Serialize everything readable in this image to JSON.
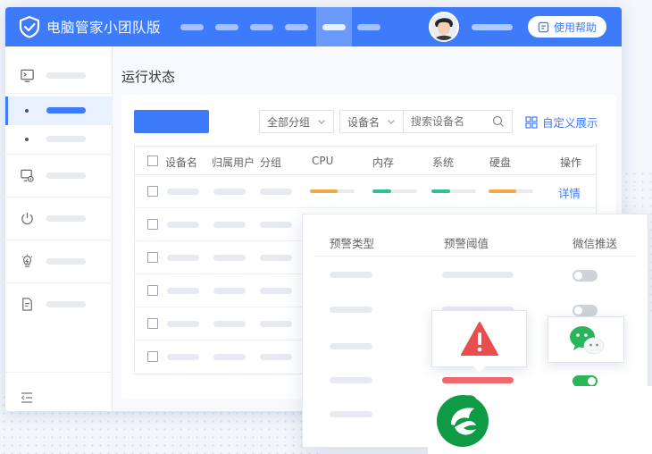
{
  "app": {
    "title": "电脑管家小团队版",
    "help_label": "使用帮助"
  },
  "colors": {
    "accent": "#3d7bfa",
    "warning": "#e94e4e",
    "success": "#2bb55a",
    "cpu_bar": "#f0a84a",
    "mem_bar": "#2ec28c"
  },
  "page": {
    "title": "运行状态"
  },
  "toolbar": {
    "group_select": "全部分组",
    "device_select": "设备名",
    "search_placeholder": "搜索设备名",
    "custom_label": "自定义展示"
  },
  "table": {
    "headers": [
      "设备名",
      "归属用户",
      "分组",
      "CPU",
      "内存",
      "系统",
      "硬盘",
      "操作"
    ],
    "first_row_action": "详情",
    "first_row_levels": {
      "cpu": 0.62,
      "mem": 0.42,
      "sys": 0.42,
      "disk": 0.62
    }
  },
  "alert_panel": {
    "headers": [
      "预警类型",
      "预警阈值",
      "微信推送"
    ],
    "toggles": [
      false,
      false,
      false,
      true,
      null
    ]
  },
  "icons": {
    "logo": "shield-check-icon",
    "sidebar": [
      "terminal-icon",
      "computer-settings-icon",
      "power-icon",
      "bulb-bolt-icon",
      "document-icon",
      "collapse-menu-icon"
    ],
    "warning": "warning-triangle-icon",
    "wechat": "wechat-icon",
    "brand": "green-leaf-logo"
  }
}
